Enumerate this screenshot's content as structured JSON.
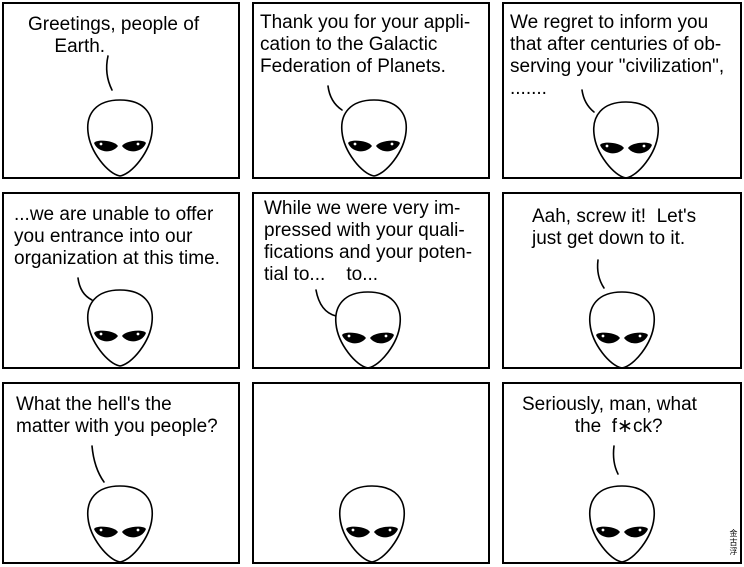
{
  "comic": {
    "panels": [
      {
        "caption": "Greetings, people of\n     Earth."
      },
      {
        "caption": "Thank you for your appli-\ncation to the Galactic\nFederation of Planets."
      },
      {
        "caption": "We regret to inform you\nthat after centuries of ob-\nserving your \"civilization\",\n......."
      },
      {
        "caption": "...we are unable to offer\nyou entrance into our\norganization at this time."
      },
      {
        "caption": "While we were very im-\npressed with your quali-\nfications and your poten-\ntial to...    to..."
      },
      {
        "caption": "Aah, screw it!  Let's\njust get down to it."
      },
      {
        "caption": "What the hell's the\nmatter with you people?"
      },
      {
        "caption": ""
      },
      {
        "caption": "Seriously, man, what\n          the  f∗ck?"
      }
    ],
    "signature": "金\n古\n浮"
  }
}
